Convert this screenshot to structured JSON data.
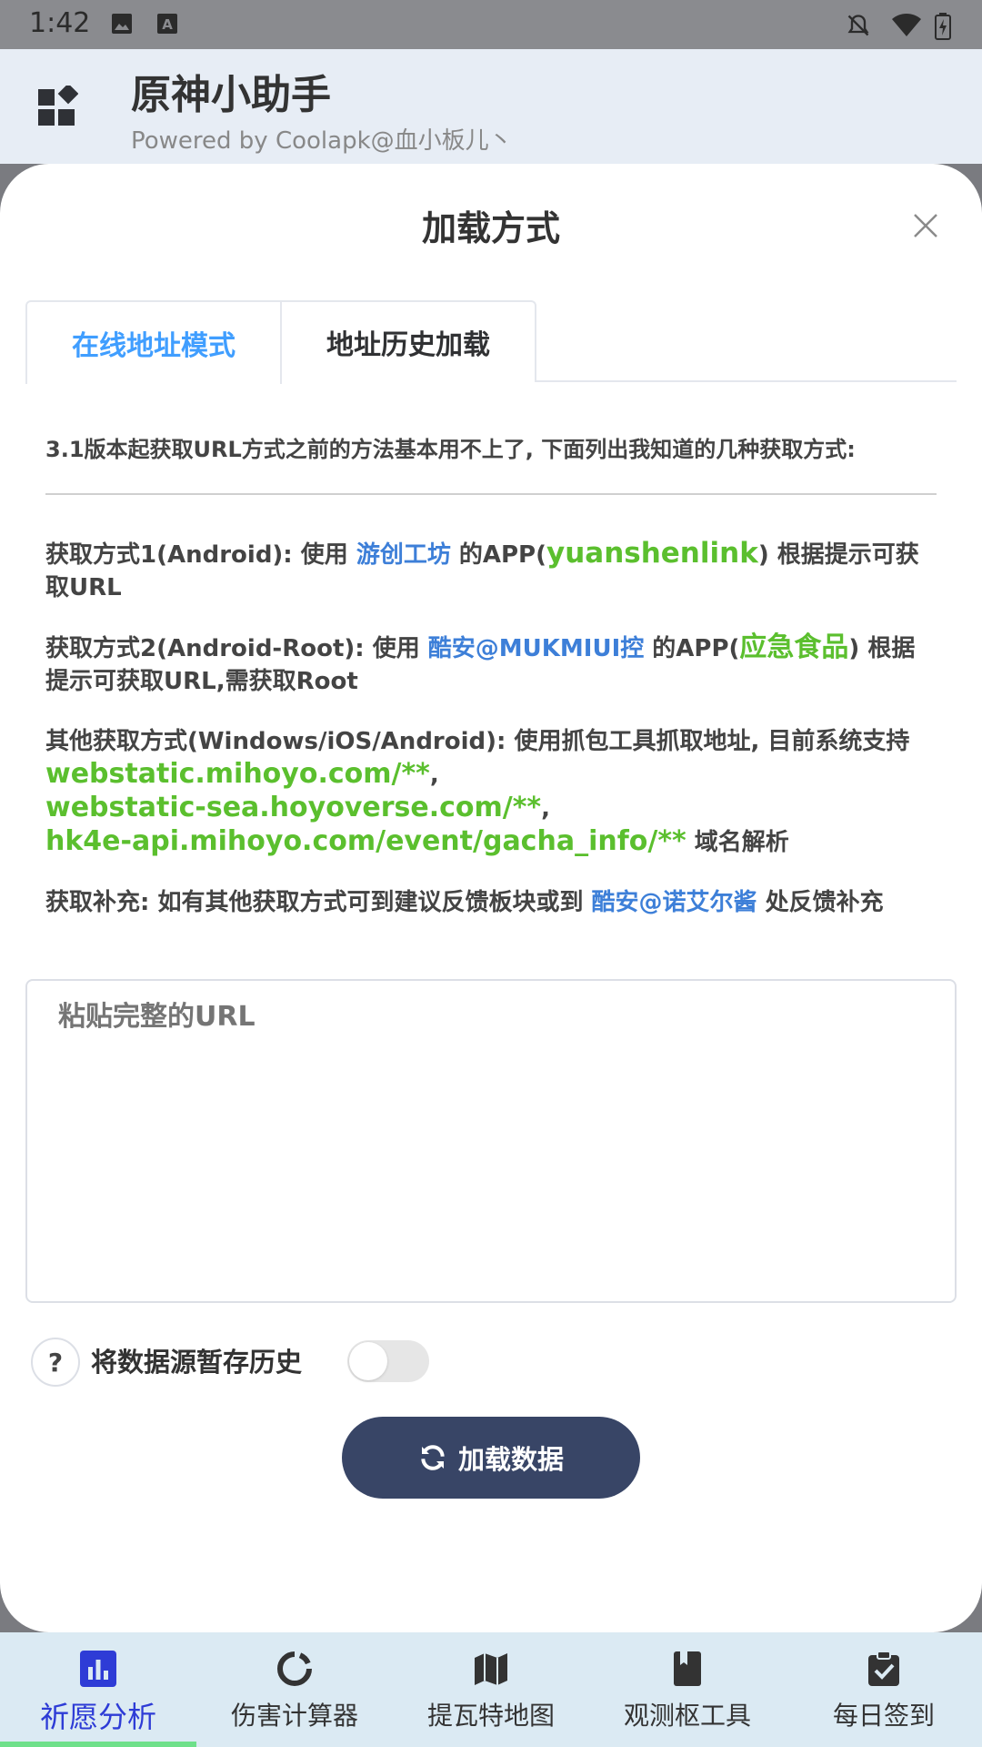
{
  "status_bar": {
    "time": "1:42",
    "icons": [
      "image-icon",
      "a-icon",
      "bell-off-icon",
      "wifi-icon",
      "battery-icon"
    ]
  },
  "app": {
    "title": "原神小助手",
    "subtitle": "Powered by Coolapk@血小板儿丶"
  },
  "modal": {
    "title": "加载方式",
    "tabs": [
      {
        "label": "在线地址模式",
        "active": true
      },
      {
        "label": "地址历史加载",
        "active": false
      }
    ],
    "intro": "3.1版本起获取URL方式之前的方法基本用不上了, 下面列出我知道的几种获取方式:",
    "method1": {
      "prefix": "获取方式1(Android): 使用 ",
      "link": "游创工坊",
      "mid": " 的APP(",
      "app": "yuanshenlink",
      "suffix": ") 根据提示可获取URL"
    },
    "method2": {
      "prefix": "获取方式2(Android-Root): 使用 ",
      "link": "酷安@MUKMIUI控",
      "mid": " 的APP(",
      "app": "应急食品",
      "suffix": ") 根据提示可获取URL,需获取Root"
    },
    "method3": {
      "prefix": "其他获取方式(Windows/iOS/Android): 使用抓包工具抓取地址, 目前系统支持",
      "domain1": "webstatic.mihoyo.com/**",
      "domain2": "webstatic-sea.hoyoverse.com/**",
      "domain3": "hk4e-api.mihoyo.com/event/gacha_info/**",
      "suffix": " 域名解析"
    },
    "supplement": {
      "prefix": "获取补充: 如有其他获取方式可到建议反馈板块或到 ",
      "link": "酷安@诺艾尔酱",
      "suffix": " 处反馈补充"
    },
    "url_input": {
      "value": "",
      "placeholder": "粘贴完整的URL"
    },
    "help_label": "?",
    "toggle_label": "将数据源暂存历史",
    "toggle_on": false,
    "load_button": "加载数据"
  },
  "colors": {
    "accent_blue": "#409eff",
    "link_blue": "#3d7fd8",
    "link_green": "#5bbf2e",
    "button_dark": "#384566",
    "nav_active": "#2e3cd6"
  },
  "bottom_nav": {
    "items": [
      {
        "label": "祈愿分析",
        "icon": "bar-chart-icon",
        "active": true
      },
      {
        "label": "伤害计算器",
        "icon": "circle-notch-icon",
        "active": false
      },
      {
        "label": "提瓦特地图",
        "icon": "map-icon",
        "active": false
      },
      {
        "label": "观测枢工具",
        "icon": "bookmark-book-icon",
        "active": false
      },
      {
        "label": "每日签到",
        "icon": "clipboard-check-icon",
        "active": false
      }
    ]
  }
}
